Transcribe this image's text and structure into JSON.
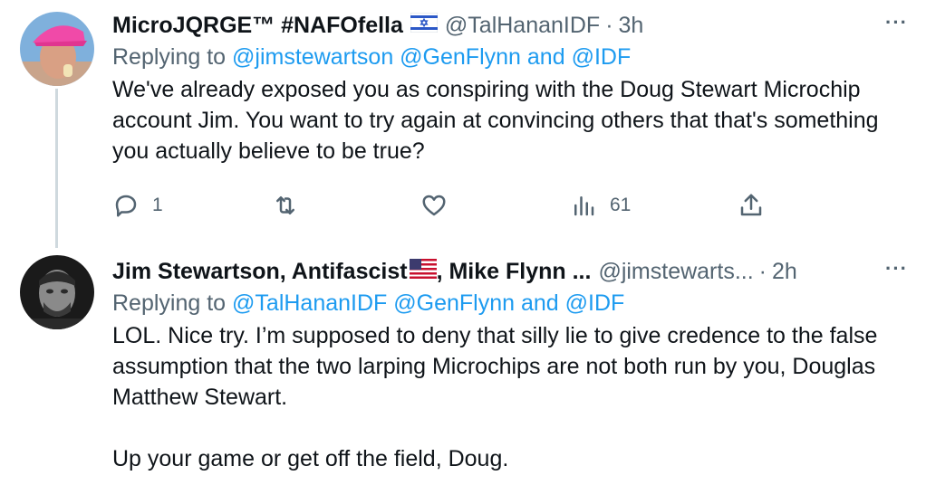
{
  "tweets": [
    {
      "name": "MicroJQRGE™ #NAFOfella",
      "flag": "israel-flag-icon",
      "handle": "@TalHananIDF",
      "time": "3h",
      "replying_prefix": "Replying to",
      "replying_to": "@jimstewartson @GenFlynn",
      "replying_and": "and",
      "replying_last": "@IDF",
      "text": "We've already exposed you as conspiring with the Doug Stewart Microchip account Jim. You want to try again at convincing others that that's something you actually believe to be true?",
      "stats": {
        "replies": "1",
        "retweets": "",
        "likes": "",
        "views": "61"
      },
      "more": "···"
    },
    {
      "name_part1": "Jim Stewartson, Antifascist",
      "flag": "us-flag-icon",
      "name_part2": ", Mike Flynn ...",
      "handle": "@jimstewarts...",
      "time": "2h",
      "replying_prefix": "Replying to",
      "replying_to": "@TalHananIDF @GenFlynn",
      "replying_and": "and",
      "replying_last": "@IDF",
      "text_line1": "LOL. Nice try. I’m supposed to deny that silly lie to give credence to the false assumption that the two larping Microchips are not both run by you, Douglas Matthew Stewart.",
      "text_line2": "Up your game or get off the field, Doug.",
      "more": "···"
    }
  ],
  "colors": {
    "text": "#0f1419",
    "muted": "#536471",
    "link": "#1d9bf0",
    "line": "#cfd9de"
  }
}
